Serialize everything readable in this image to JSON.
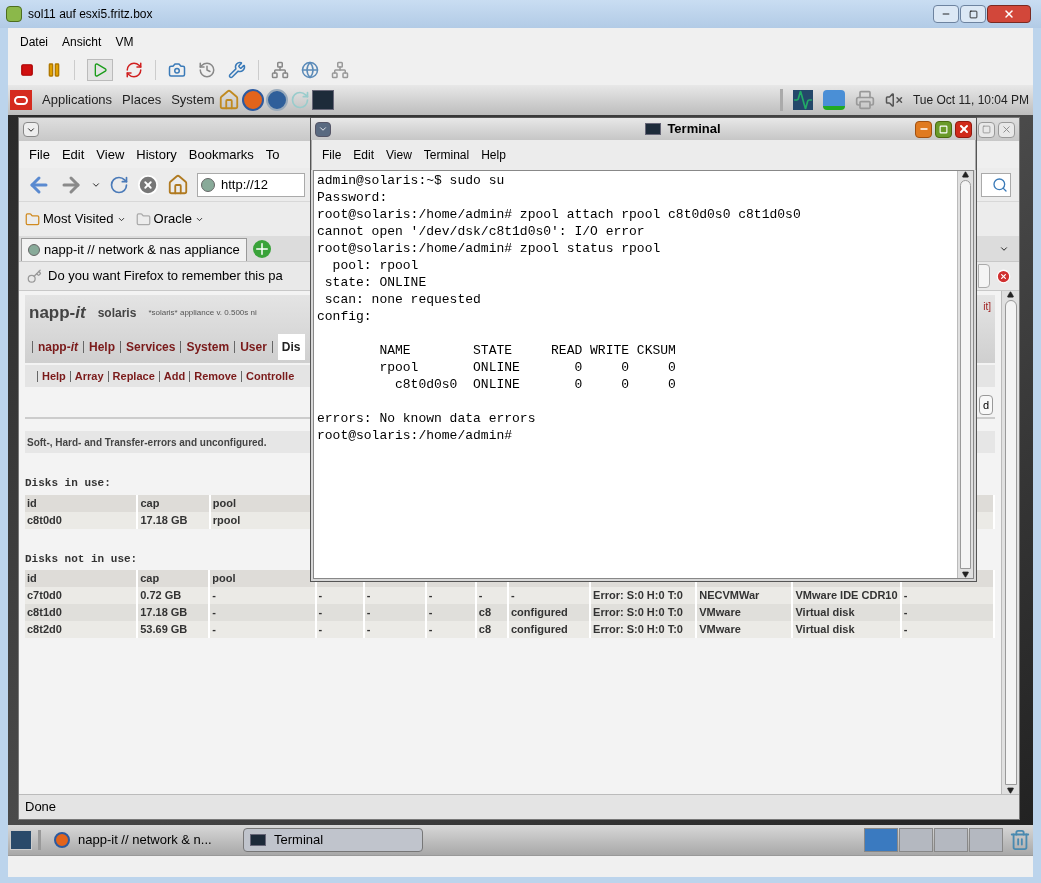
{
  "vm_window": {
    "title": "sol11 auf esxi5.fritz.box",
    "menu": [
      "Datei",
      "Ansicht",
      "VM"
    ]
  },
  "top_panel": {
    "menus": [
      "Applications",
      "Places",
      "System"
    ],
    "clock": "Tue Oct 11, 10:04 PM"
  },
  "firefox": {
    "menu": [
      "File",
      "Edit",
      "View",
      "History",
      "Bookmarks",
      "To"
    ],
    "address": "http://12",
    "bookmarks": [
      "Most Visited",
      "Oracle"
    ],
    "tab": "napp-it // network & nas appliance",
    "notification": "Do you want Firefox to remember this pa",
    "status": "Done",
    "page": {
      "brand": "napp-*it*",
      "host": "solaris",
      "version": "*solaris* appliance v. 0.500s ni",
      "corner_link": "it]",
      "nav": [
        {
          "label": "napp-*it*",
          "selected": false
        },
        {
          "label": "Help",
          "selected": false
        },
        {
          "label": "Services",
          "selected": false
        },
        {
          "label": "System",
          "selected": false
        },
        {
          "label": "User",
          "selected": false
        },
        {
          "label": "Dis",
          "selected": true
        }
      ],
      "subnav": [
        "Help",
        "Array",
        "Replace",
        "Add",
        "Remove",
        "Controlle"
      ],
      "button": "d",
      "info": "Soft-, Hard- and Transfer-errors and unconfigured.",
      "disks_in_use": {
        "title": "Disks in use:",
        "columns": [
          "id",
          "cap",
          "pool"
        ],
        "rows": [
          [
            "c8t0d0",
            "17.18 GB",
            "rpool"
          ]
        ]
      },
      "disks_not_in_use": {
        "title": "Disks not in use:",
        "columns": [
          "id",
          "cap",
          "pool"
        ],
        "rows": [
          [
            "c7t0d0",
            "0.72 GB",
            "-",
            "-",
            "-",
            "-",
            "-",
            "-",
            "Error: S:0 H:0 T:0",
            "NECVMWar",
            "VMware IDE CDR10",
            "-"
          ],
          [
            "c8t1d0",
            "17.18 GB",
            "-",
            "-",
            "-",
            "-",
            "c8",
            "configured",
            "Error: S:0 H:0 T:0",
            "VMware",
            "Virtual disk",
            "-"
          ],
          [
            "c8t2d0",
            "53.69 GB",
            "-",
            "-",
            "-",
            "-",
            "c8",
            "configured",
            "Error: S:0 H:0 T:0",
            "VMware",
            "Virtual disk",
            "-"
          ]
        ]
      }
    }
  },
  "terminal": {
    "title": "Terminal",
    "menu": [
      "File",
      "Edit",
      "View",
      "Terminal",
      "Help"
    ],
    "output": "admin@solaris:~$ sudo su\nPassword:\nroot@solaris:/home/admin# zpool attach rpool c8t0d0s0 c8t1d0s0\ncannot open '/dev/dsk/c8t1d0s0': I/O error\nroot@solaris:/home/admin# zpool status rpool\n  pool: rpool\n state: ONLINE\n scan: none requested\nconfig:\n\n        NAME        STATE     READ WRITE CKSUM\n        rpool       ONLINE       0     0     0\n          c8t0d0s0  ONLINE       0     0     0\n\nerrors: No known data errors\nroot@solaris:/home/admin#"
  },
  "taskbar": {
    "items": [
      {
        "kind": "browser",
        "label": "napp-it // network & n...",
        "selected": false
      },
      {
        "kind": "terminal",
        "label": "Terminal",
        "selected": true
      }
    ],
    "workspaces": [
      {
        "selected": true
      },
      {
        "selected": false
      },
      {
        "selected": false
      },
      {
        "selected": false
      }
    ]
  }
}
